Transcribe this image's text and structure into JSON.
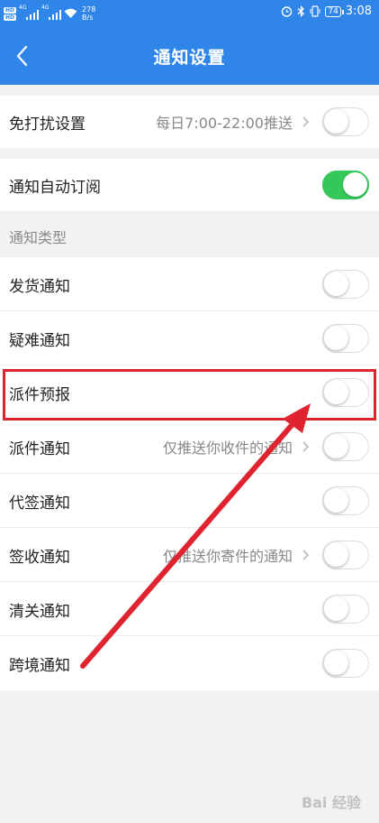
{
  "status_bar": {
    "hd_top": "HD",
    "hd_bottom": "HD",
    "net1": "4G",
    "net2": "4G",
    "speed_value": "278",
    "speed_unit": "B/s",
    "battery": "74",
    "time": "3:08"
  },
  "navbar": {
    "title": "通知设置",
    "back_icon": "chevron-left-icon"
  },
  "settings": {
    "dnd": {
      "label": "免打扰设置",
      "hint": "每日7:00-22:00推送",
      "enabled": false
    },
    "auto_subscribe": {
      "label": "通知自动订阅",
      "enabled": true
    }
  },
  "notification_types": {
    "header": "通知类型",
    "items": [
      {
        "label": "发货通知",
        "hint": "",
        "enabled": false
      },
      {
        "label": "疑难通知",
        "hint": "",
        "enabled": false
      },
      {
        "label": "派件预报",
        "hint": "",
        "enabled": false
      },
      {
        "label": "派件通知",
        "hint": "仅推送你收件的通知",
        "enabled": false
      },
      {
        "label": "代签通知",
        "hint": "",
        "enabled": false
      },
      {
        "label": "签收通知",
        "hint": "仅推送你寄件的通知",
        "enabled": false
      },
      {
        "label": "清关通知",
        "hint": "",
        "enabled": false
      },
      {
        "label": "跨境通知",
        "hint": "",
        "enabled": false
      }
    ]
  },
  "colors": {
    "header_bg": "#2f86e8",
    "toggle_on": "#35c759",
    "annotation": "#e0242f"
  },
  "watermark": "Bai 经验"
}
